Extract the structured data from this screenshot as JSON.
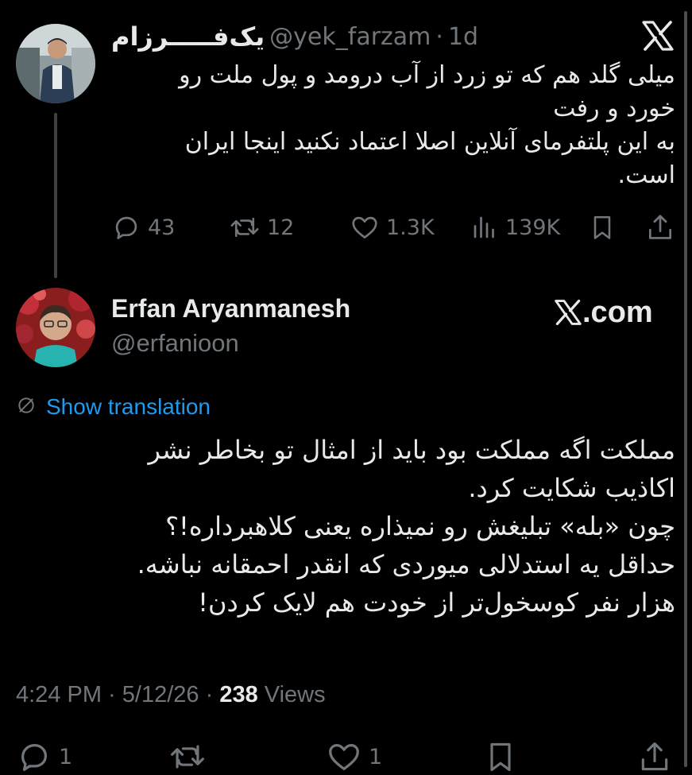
{
  "parent_tweet": {
    "display_name": "یک‌فـــــرزام",
    "handle": "@yek_farzam",
    "separator": "·",
    "time": "1d",
    "text": "میلی گلد هم که تو زرد از آب درومد و پول ملت رو\nخورد و رفت\nبه این پلتفرمای آنلاین اصلا اعتماد نکنید اینجا ایران\nاست.",
    "stats": {
      "replies": "43",
      "reposts": "12",
      "likes": "1.3K",
      "views": "139K"
    }
  },
  "reply_tweet": {
    "display_name": "Erfan Aryanmanesh",
    "handle": "@erfanioon",
    "brand": ".com",
    "translation_label": "Show translation",
    "text": "مملکت اگه مملکت بود باید از امثال  تو بخاطر نشر\nاکاذیب شکایت کرد.\nچون «بله» تبلیغش رو نمیذاره یعنی کلاهبرداره!؟\nحداقل یه استدلالی میوردی که انقدر احمقانه نباشه.\nهزار نفر کوسخول‌تر از خودت هم لایک کردن!",
    "timestamp": "4:24 PM · 5/12/26 · ",
    "views_count": "238",
    "views_label": " Views",
    "stats": {
      "replies": "1",
      "likes": "1"
    }
  },
  "icons": [
    "x-logo-icon",
    "reply-icon",
    "repost-icon",
    "like-icon",
    "views-icon",
    "bookmark-icon",
    "share-icon",
    "translate-icon"
  ],
  "colors": {
    "background": "#000000",
    "text": "#e7e9ea",
    "muted": "#71767b",
    "link": "#1d9bf0"
  }
}
